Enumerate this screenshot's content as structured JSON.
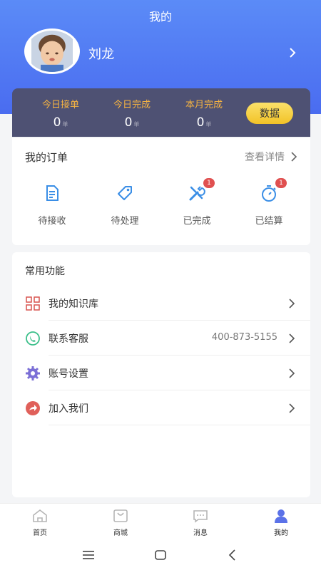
{
  "header": {
    "title": "我的"
  },
  "profile": {
    "name": "刘龙"
  },
  "stats": [
    {
      "label": "今日接单",
      "value": "0",
      "unit": "单"
    },
    {
      "label": "今日完成",
      "value": "0",
      "unit": "单"
    },
    {
      "label": "本月完成",
      "value": "0",
      "unit": "单"
    }
  ],
  "data_button": "数据",
  "orders": {
    "title": "我的订单",
    "view_detail": "查看详情",
    "items": [
      {
        "label": "待接收",
        "icon": "document-icon",
        "badge": ""
      },
      {
        "label": "待处理",
        "icon": "tag-icon",
        "badge": ""
      },
      {
        "label": "已完成",
        "icon": "tools-icon",
        "badge": "1"
      },
      {
        "label": "已结算",
        "icon": "stopwatch-icon",
        "badge": "1"
      }
    ]
  },
  "functions": {
    "title": "常用功能",
    "items": [
      {
        "label": "我的知识库",
        "icon": "grid-icon",
        "value": ""
      },
      {
        "label": "联系客服",
        "icon": "phone-icon",
        "value": "400-873-5155"
      },
      {
        "label": "账号设置",
        "icon": "gear-icon",
        "value": ""
      },
      {
        "label": "加入我们",
        "icon": "share-icon",
        "value": ""
      }
    ]
  },
  "tabs": [
    {
      "label": "首页",
      "icon": "home-icon",
      "active": false
    },
    {
      "label": "商城",
      "icon": "mall-icon",
      "active": false
    },
    {
      "label": "消息",
      "icon": "message-icon",
      "active": false
    },
    {
      "label": "我的",
      "icon": "user-icon",
      "active": true
    }
  ],
  "colors": {
    "header_blue": "#4a6cf0",
    "stats_bg": "#4e5173",
    "stat_label": "#f5b342",
    "data_button": "#f2c227",
    "icon_blue": "#3a8ee6",
    "badge_red": "#e05050",
    "active_tab": "#5b72e8"
  }
}
